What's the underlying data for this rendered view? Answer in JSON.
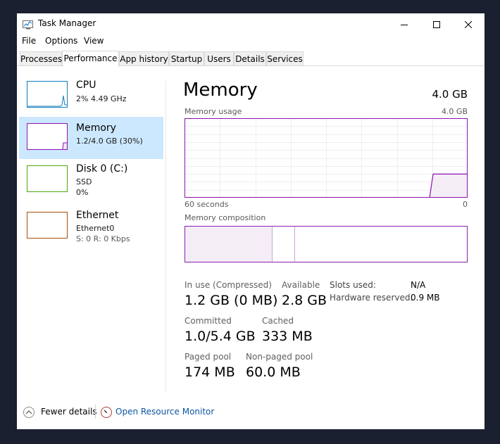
{
  "window": {
    "title": "Task Manager",
    "app_icon": "task-manager-icon",
    "controls": [
      "minimize-icon",
      "maximize-icon",
      "close-icon"
    ]
  },
  "menu": [
    "File",
    "Options",
    "View"
  ],
  "tabs": [
    "Processes",
    "Performance",
    "App history",
    "Startup",
    "Users",
    "Details",
    "Services"
  ],
  "active_tab": "Performance",
  "sidebar": {
    "items": [
      {
        "name": "CPU",
        "line1": "2%  4.49 GHz",
        "line2": "",
        "color": "#117dbb"
      },
      {
        "name": "Memory",
        "line1": "1.2/4.0 GB (30%)",
        "line2": "",
        "color": "#8b12ae",
        "selected": true
      },
      {
        "name": "Disk 0 (C:)",
        "line1": "SSD",
        "line2": "0%",
        "color": "#4da60c"
      },
      {
        "name": "Ethernet",
        "line1": "Ethernet0",
        "line2": "S: 0 R: 0 Kbps",
        "color": "#a74f01"
      }
    ]
  },
  "main": {
    "title": "Memory",
    "total": "4.0 GB",
    "usage_label": "Memory usage",
    "usage_max": "4.0 GB",
    "time_left": "60 seconds",
    "time_right": "0",
    "composition_label": "Memory composition",
    "composition": {
      "in_use_fraction": 0.31,
      "modified_fraction": 0.08
    },
    "usage_level_fraction": 0.3,
    "stats": {
      "in_use_label": "In use (Compressed)",
      "in_use_value": "1.2 GB (0 MB)",
      "available_label": "Available",
      "available_value": "2.8 GB",
      "committed_label": "Committed",
      "committed_value": "1.0/5.4 GB",
      "cached_label": "Cached",
      "cached_value": "333 MB",
      "paged_label": "Paged pool",
      "paged_value": "174 MB",
      "nonpaged_label": "Non-paged pool",
      "nonpaged_value": "60.0 MB"
    },
    "details": {
      "slots_label": "Slots used:",
      "slots_value": "N/A",
      "reserved_label": "Hardware reserved:",
      "reserved_value": "0.9 MB"
    }
  },
  "footer": {
    "fewer_details": "Fewer details",
    "fewer_icon": "chevron-up-icon",
    "resource_monitor": "Open Resource Monitor",
    "resource_icon": "resource-monitor-icon",
    "link_color": "#0b57a3"
  }
}
